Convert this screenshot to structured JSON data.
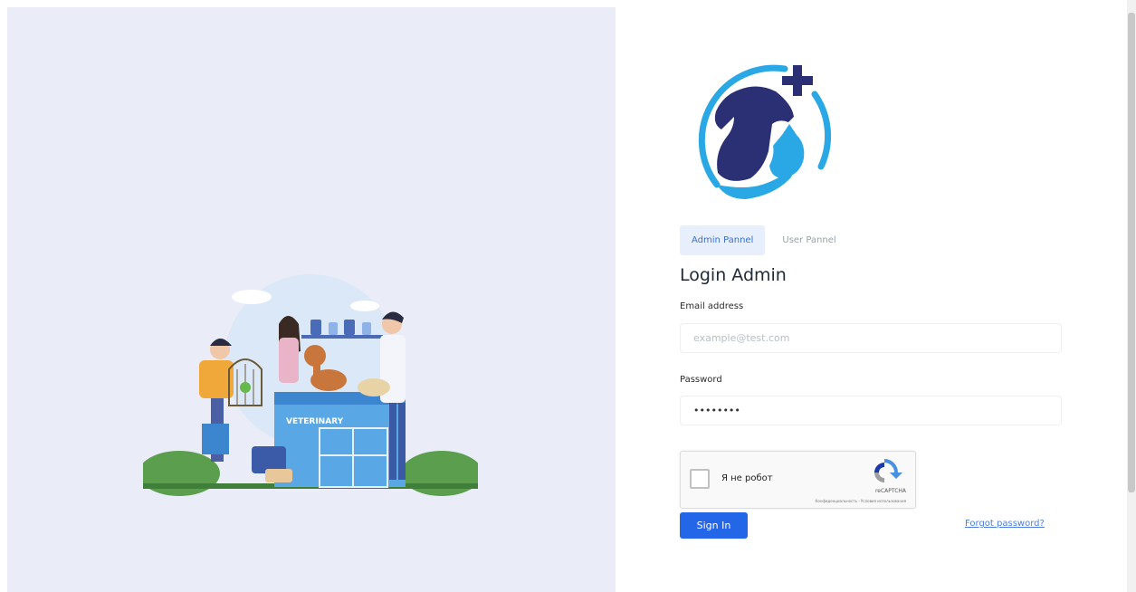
{
  "login": {
    "tabs": [
      {
        "label": "Admin Pannel",
        "active": true
      },
      {
        "label": "User Pannel",
        "active": false
      }
    ],
    "heading": "Login Admin",
    "email": {
      "label": "Email address",
      "placeholder": "example@test.com",
      "value": ""
    },
    "password": {
      "label": "Password",
      "value": "••••••••"
    },
    "recaptcha": {
      "label": "Я не робот",
      "brand": "reCAPTCHA",
      "links": "Конфиденциальность - Условия использования"
    },
    "signin_label": "Sign In",
    "forgot_label": "Forgot password?"
  },
  "illustration": {
    "sign_text": "VETERINARY"
  },
  "colors": {
    "accent": "#2466e8",
    "logo_navy": "#2b2f73",
    "logo_cyan": "#2aa8e6",
    "left_bg": "#eaedf7"
  },
  "icons": [
    "vet-clinic-logo",
    "recaptcha-icon",
    "veterinary-illustration"
  ]
}
